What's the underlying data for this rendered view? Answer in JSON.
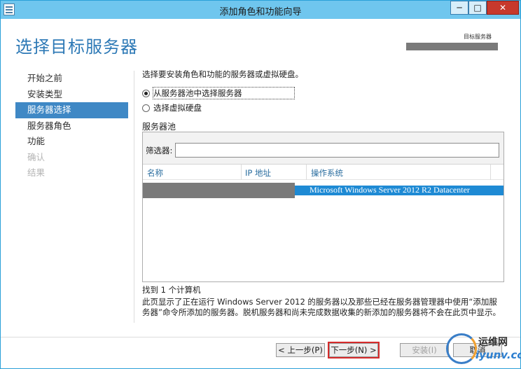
{
  "window": {
    "title": "添加角色和功能向导"
  },
  "header": {
    "title": "选择目标服务器",
    "target_label": "目标服务器"
  },
  "nav": {
    "items": [
      {
        "label": "开始之前",
        "state": "normal"
      },
      {
        "label": "安装类型",
        "state": "normal"
      },
      {
        "label": "服务器选择",
        "state": "active"
      },
      {
        "label": "服务器角色",
        "state": "normal"
      },
      {
        "label": "功能",
        "state": "normal"
      },
      {
        "label": "确认",
        "state": "disabled"
      },
      {
        "label": "结果",
        "state": "disabled"
      }
    ]
  },
  "content": {
    "intro": "选择要安装角色和功能的服务器或虚拟硬盘。",
    "options": [
      {
        "label": "从服务器池中选择服务器",
        "checked": true
      },
      {
        "label": "选择虚拟硬盘",
        "checked": false
      }
    ],
    "pool_heading": "服务器池",
    "filter": {
      "label": "筛选器:",
      "value": ""
    },
    "columns": [
      "名称",
      "IP 地址",
      "操作系统"
    ],
    "rows": [
      {
        "name": "",
        "ip": "",
        "os": "Microsoft Windows Server 2012 R2 Datacenter"
      }
    ],
    "found": "找到 1 个计算机",
    "description": "此页显示了正在运行 Windows Server 2012 的服务器以及那些已经在服务器管理器中使用“添加服务器”命令所添加的服务器。脱机服务器和尚未完成数据收集的新添加的服务器将不会在此页中显示。"
  },
  "footer": {
    "prev": "< 上一步(P)",
    "next": "下一步(N) >",
    "install": "安装(I)",
    "cancel": "取消"
  },
  "watermark": {
    "line1": "运维网",
    "line2": "iyunv.com"
  },
  "colors": {
    "accent": "#3f88c5",
    "title_blue": "#2d79b6",
    "titlebar": "#6fc6ee",
    "selected_row": "#1e8ad4"
  }
}
